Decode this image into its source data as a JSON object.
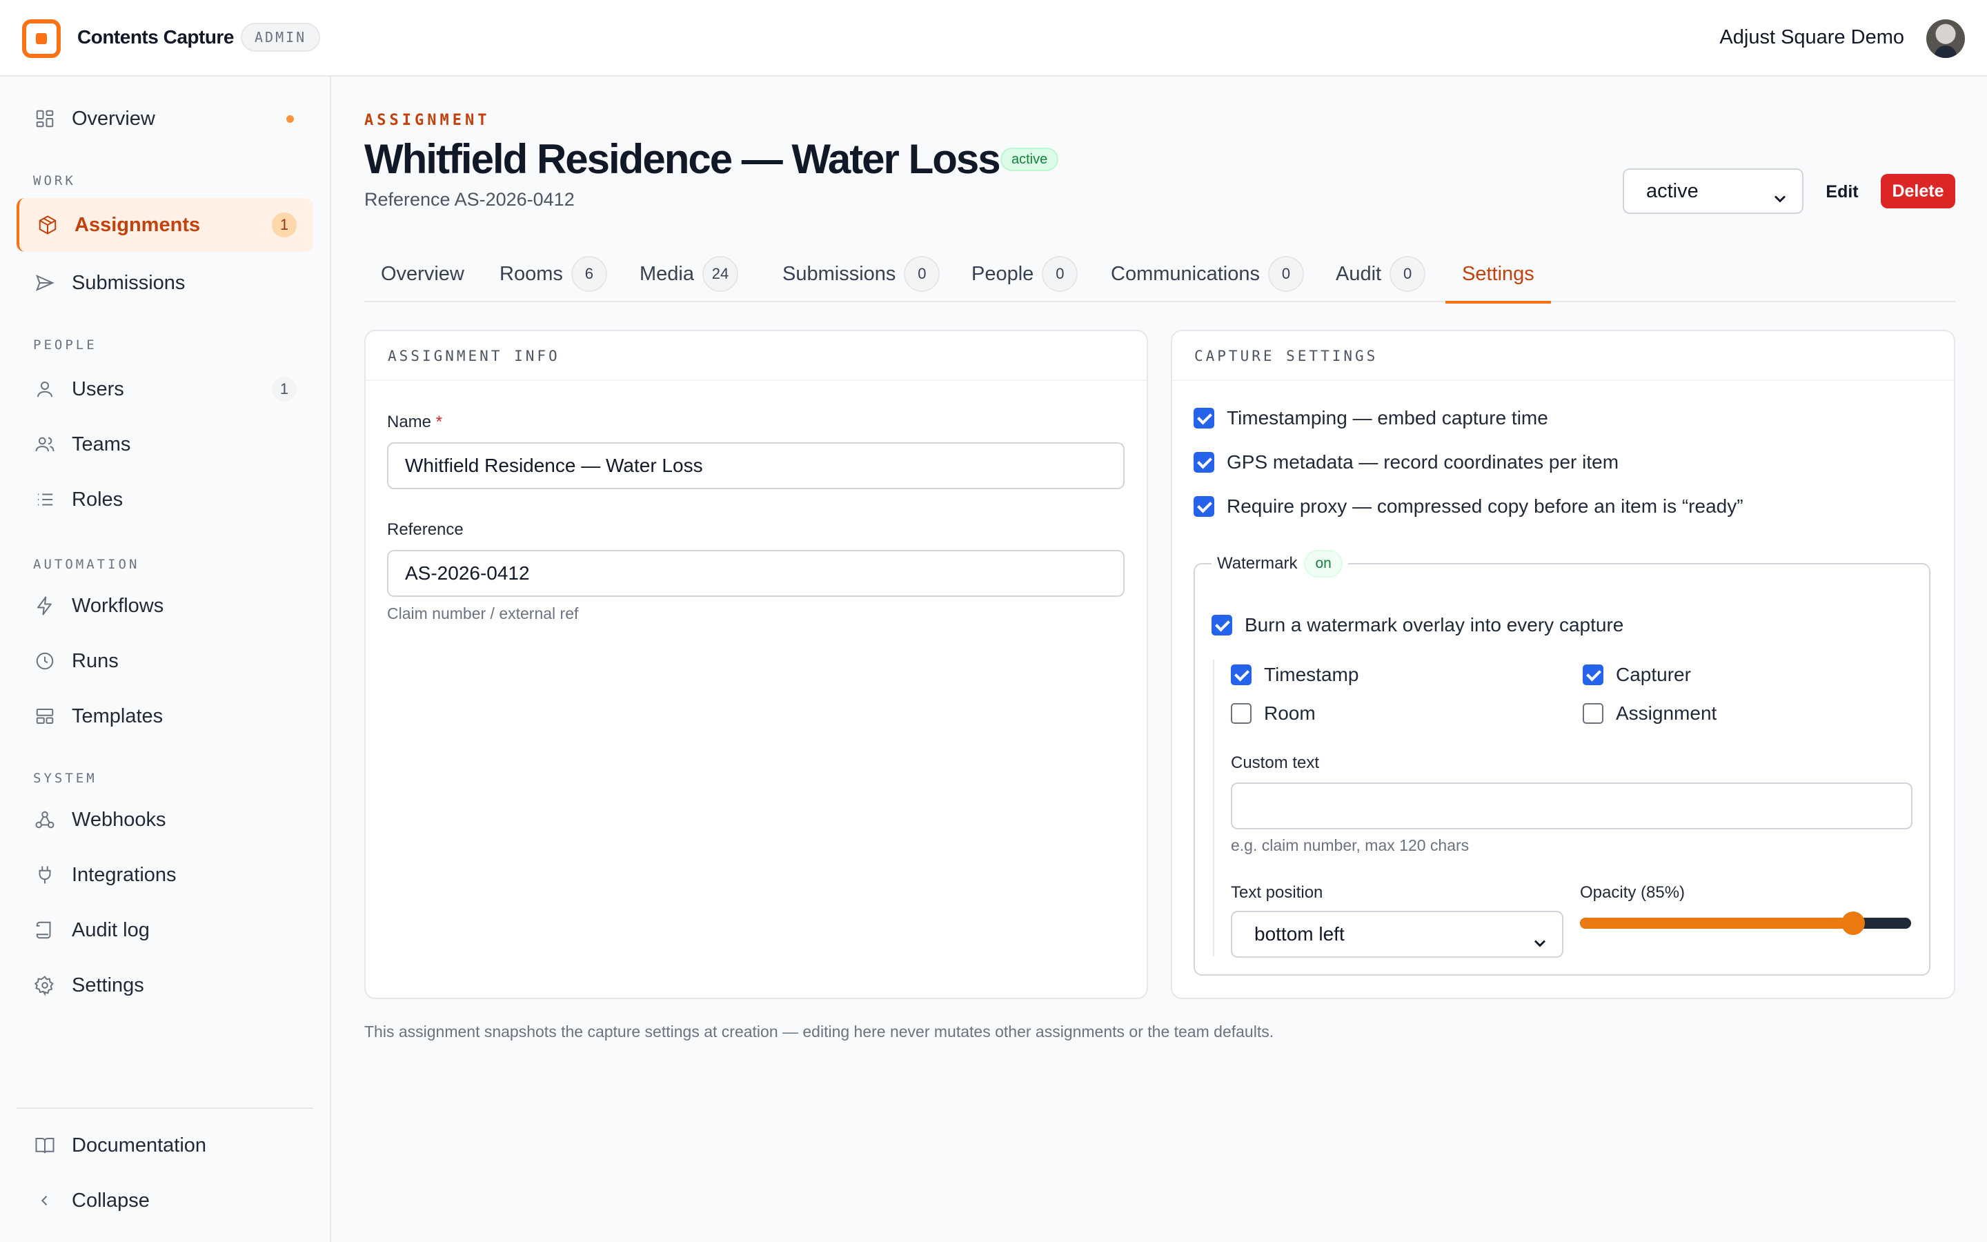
{
  "app": {
    "name": "Contents Capture",
    "badge": "ADMIN",
    "org": "Adjust Square Demo"
  },
  "sidebar": {
    "overview": "Overview",
    "sections": {
      "work": "WORK",
      "people": "PEOPLE",
      "automation": "AUTOMATION",
      "system": "SYSTEM"
    },
    "items": {
      "assignments": {
        "label": "Assignments",
        "count": "1"
      },
      "submissions": {
        "label": "Submissions"
      },
      "users": {
        "label": "Users",
        "count": "1"
      },
      "teams": {
        "label": "Teams"
      },
      "roles": {
        "label": "Roles"
      },
      "workflows": {
        "label": "Workflows"
      },
      "runs": {
        "label": "Runs"
      },
      "templates": {
        "label": "Templates"
      },
      "webhooks": {
        "label": "Webhooks"
      },
      "integrations": {
        "label": "Integrations"
      },
      "audit_log": {
        "label": "Audit log"
      },
      "settings": {
        "label": "Settings"
      },
      "documentation": {
        "label": "Documentation"
      },
      "collapse": {
        "label": "Collapse"
      }
    }
  },
  "header": {
    "eyebrow": "ASSIGNMENT",
    "title": "Whitfield Residence — Water Loss",
    "status_pill": "active",
    "reference": "Reference AS-2026-0412",
    "status_select": "active",
    "edit_label": "Edit",
    "delete_label": "Delete"
  },
  "tabs": [
    {
      "label": "Overview"
    },
    {
      "label": "Rooms",
      "count": "6"
    },
    {
      "label": "Media",
      "count": "24"
    },
    {
      "label": "Submissions",
      "count": "0"
    },
    {
      "label": "People",
      "count": "0"
    },
    {
      "label": "Communications",
      "count": "0"
    },
    {
      "label": "Audit",
      "count": "0"
    },
    {
      "label": "Settings",
      "active": true
    }
  ],
  "info": {
    "heading": "ASSIGNMENT INFO",
    "name_label": "Name",
    "required_mark": "*",
    "name_value": "Whitfield Residence — Water Loss",
    "reference_label": "Reference",
    "reference_value": "AS-2026-0412",
    "reference_hint": "Claim number / external ref"
  },
  "capture": {
    "heading": "CAPTURE SETTINGS",
    "timestamping": {
      "label": "Timestamping — embed capture time",
      "checked": true
    },
    "gps": {
      "label": "GPS metadata — record coordinates per item",
      "checked": true
    },
    "proxy": {
      "label": "Require proxy — compressed copy before an item is “ready”",
      "checked": true
    },
    "watermark": {
      "legend": "Watermark",
      "state": "on",
      "burn": {
        "label": "Burn a watermark overlay into every capture",
        "checked": true
      },
      "timestamp": {
        "label": "Timestamp",
        "checked": true
      },
      "capturer": {
        "label": "Capturer",
        "checked": true
      },
      "room": {
        "label": "Room",
        "checked": false
      },
      "assignment": {
        "label": "Assignment",
        "checked": false
      },
      "custom_text_label": "Custom text",
      "custom_text_value": "",
      "custom_text_hint": "e.g. claim number, max 120 chars",
      "position_label": "Text position",
      "position_value": "bottom left",
      "opacity_label": "Opacity (85%)",
      "opacity": 0.85
    }
  },
  "footnote": "This assignment snapshots the capture settings at creation — editing here never mutates other assignments or the team defaults.",
  "colors": {
    "accent": "#f97316",
    "danger": "#dc2626",
    "checkbox": "#2563eb",
    "success": "#15803d"
  }
}
